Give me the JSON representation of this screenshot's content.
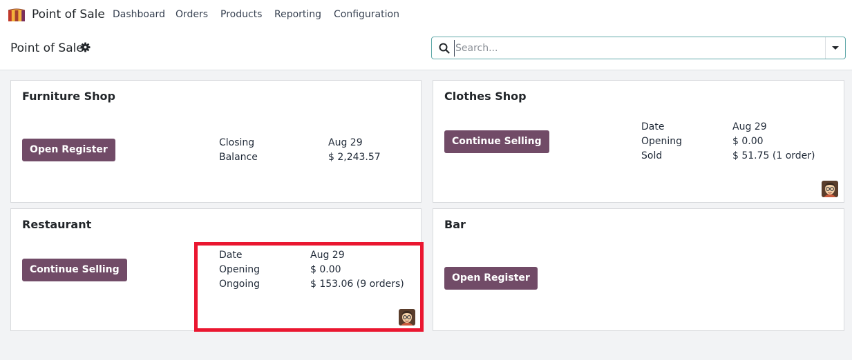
{
  "app": {
    "name": "Point of Sale",
    "icon": "pos-awning-icon"
  },
  "menu": [
    "Dashboard",
    "Orders",
    "Products",
    "Reporting",
    "Configuration"
  ],
  "control_panel": {
    "title": "Point of Sale",
    "settings_icon": "gear-icon",
    "search": {
      "placeholder": "Search...",
      "value": ""
    }
  },
  "cards": {
    "furniture": {
      "title": "Furniture Shop",
      "button": "Open Register",
      "stats": [
        {
          "label": "Closing",
          "value": "Aug 29"
        },
        {
          "label": "Balance",
          "value": "$ 2,243.57"
        }
      ]
    },
    "clothes": {
      "title": "Clothes Shop",
      "button": "Continue Selling",
      "stats": [
        {
          "label": "Date",
          "value": "Aug 29"
        },
        {
          "label": "Opening",
          "value": "$ 0.00"
        },
        {
          "label": "Sold",
          "value": "$ 51.75 (1 order)"
        }
      ],
      "avatar": "user-avatar"
    },
    "restaurant": {
      "title": "Restaurant",
      "button": "Continue Selling",
      "stats": [
        {
          "label": "Date",
          "value": "Aug 29"
        },
        {
          "label": "Opening",
          "value": "$ 0.00"
        },
        {
          "label": "Ongoing",
          "value": "$ 153.06 (9 orders)"
        }
      ],
      "avatar": "user-avatar"
    },
    "bar": {
      "title": "Bar",
      "button": "Open Register"
    }
  },
  "colors": {
    "primary": "#714b67",
    "highlight": "#ea1630",
    "search_border": "#5fa8a9"
  }
}
